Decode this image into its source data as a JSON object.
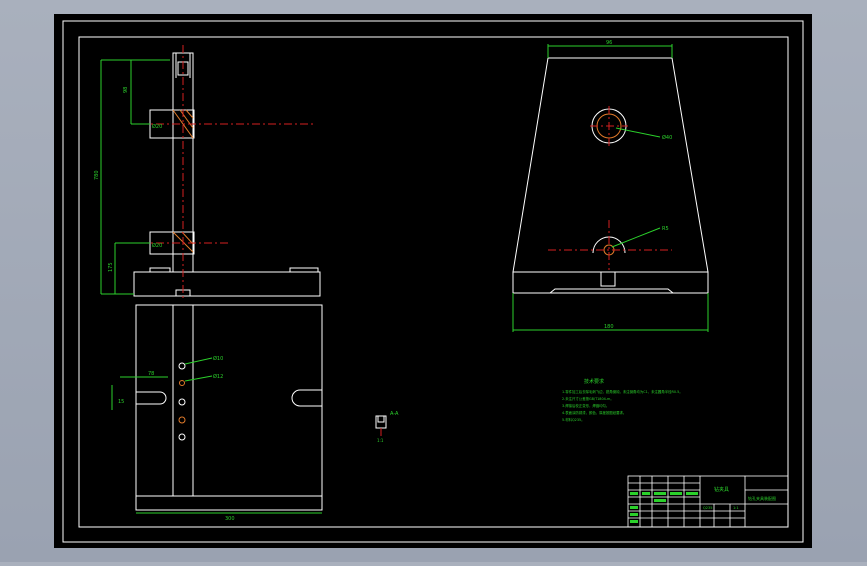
{
  "app": {
    "background_color": "#9ca3b1",
    "canvas_color": "#000000",
    "frame_color": "#ffffff",
    "dimension_color": "#2bd12b",
    "centerline_color": "#d42020",
    "hole_color": "#e07a2a"
  },
  "drawing": {
    "left_view": {
      "dim_top": "98",
      "dim_total": "780",
      "dim_bottom": "175",
      "dim_hole_top": "Ø20",
      "dim_hole_bottom": "Ø20"
    },
    "plan_view": {
      "dim_slot": "78",
      "dim_slot_depth": "15",
      "dim_width": "300",
      "callout_1": "Ø10",
      "callout_2": "Ø12"
    },
    "right_view": {
      "dim_top_width": "96",
      "dim_bottom_width": "180",
      "callout_upper": "Ø40",
      "callout_lower": "R5"
    },
    "detail_note": "A-A",
    "detail_label": "1:1",
    "notes": {
      "heading": "技术要求",
      "lines": [
        "1.零件加工后去除毛刺飞边，锐角倒钝，未注倒角均为C1，未注圆角半径R0.5。",
        "2.未注尺寸公差按GB/T1804-m。",
        "3.焊接后校正变形，焊缝均匀。",
        "4.表面涂防锈漆，颜色、厚度按图纸要求。",
        "5.材料Q235。"
      ]
    },
    "title_block": {
      "center_label": "钻夹具",
      "title": "钻孔夹具装配图",
      "material": "Q235",
      "scale": "1:1"
    }
  }
}
